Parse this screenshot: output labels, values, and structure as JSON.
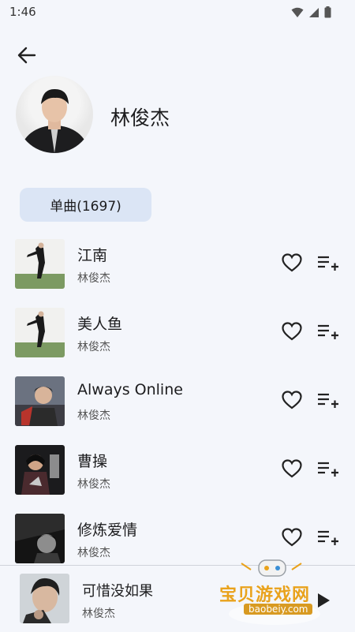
{
  "status_bar": {
    "time": "1:46"
  },
  "header": {
    "artist_name": "林俊杰"
  },
  "tabs": [
    {
      "label": "单曲(1697)"
    }
  ],
  "songs": [
    {
      "title": "江南",
      "artist": "林俊杰",
      "cover": "album-cover-1"
    },
    {
      "title": "美人鱼",
      "artist": "林俊杰",
      "cover": "album-cover-1"
    },
    {
      "title": "Always Online",
      "artist": "林俊杰",
      "cover": "album-cover-2"
    },
    {
      "title": "曹操",
      "artist": "林俊杰",
      "cover": "album-cover-3"
    },
    {
      "title": "修炼爱情",
      "artist": "林俊杰",
      "cover": "album-cover-4"
    }
  ],
  "now_playing": {
    "title": "可惜没如果",
    "artist": "林俊杰"
  },
  "watermark": {
    "text": "宝贝游戏网",
    "url": "baobeiy.com"
  },
  "colors": {
    "background": "#f4f6fb",
    "chip": "#dbe5f5",
    "watermark": "#e9a21b"
  }
}
